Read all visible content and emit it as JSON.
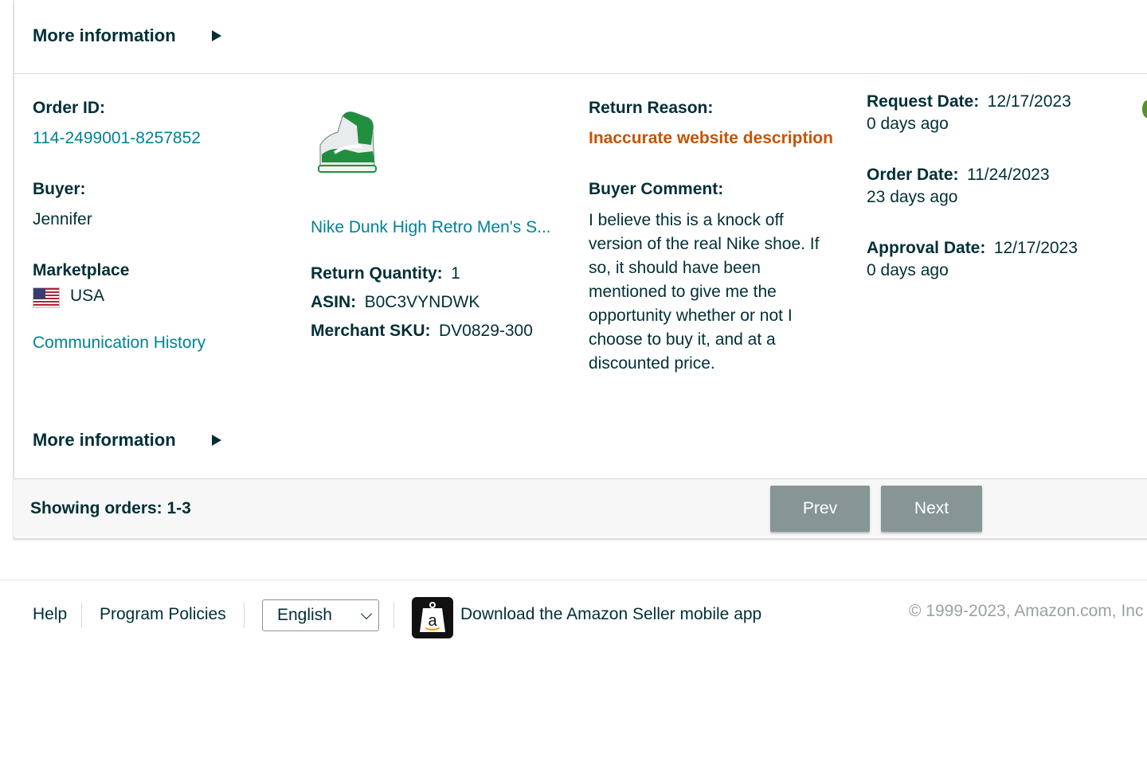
{
  "more_info": {
    "label": "More information"
  },
  "order": {
    "order_id_label": "Order ID:",
    "order_id": "114-2499001-8257852",
    "buyer_label": "Buyer:",
    "buyer": "Jennifer",
    "marketplace_label": "Marketplace",
    "marketplace": "USA",
    "communication_history": "Communication History"
  },
  "product": {
    "title": "Nike Dunk High Retro Men's S...",
    "return_quantity_label": "Return Quantity:",
    "return_quantity": "1",
    "asin_label": "ASIN:",
    "asin": "B0C3VYNDWK",
    "sku_label": "Merchant SKU:",
    "sku": "DV0829-300"
  },
  "return": {
    "reason_label": "Return Reason:",
    "reason": "Inaccurate website description",
    "comment_label": "Buyer Comment:",
    "comment": "I believe this is a knock off version of the real Nike shoe. If so, it should have been mentioned to give me the opportunity whether or not I choose to buy it, and at a discounted price."
  },
  "dates": {
    "request_label": "Request Date:",
    "request": "12/17/2023",
    "request_ago": "0 days ago",
    "order_label": "Order Date:",
    "order": "11/24/2023",
    "order_ago": "23 days ago",
    "approval_label": "Approval Date:",
    "approval": "12/17/2023",
    "approval_ago": "0 days ago"
  },
  "pager": {
    "showing": "Showing orders: 1-3",
    "prev": "Prev",
    "next": "Next"
  },
  "footer": {
    "help": "Help",
    "policies": "Program Policies",
    "language": "English",
    "app_text": "Download the Amazon Seller mobile app",
    "copyright": "© 1999-2023, Amazon.com, Inc"
  },
  "colors": {
    "text": "#002f36",
    "link": "#008296",
    "reason": "#c45500",
    "button": "#879596"
  }
}
